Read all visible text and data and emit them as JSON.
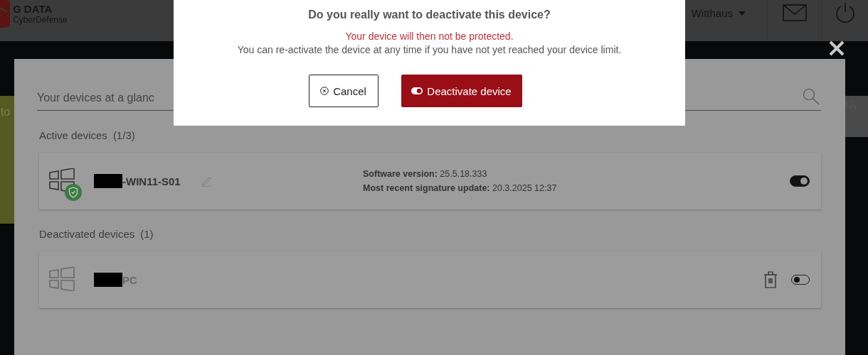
{
  "header": {
    "brand": "G DATA",
    "product": "CyberDefense",
    "user": "Witthaus"
  },
  "side_tab": "to",
  "panel": {
    "search": {
      "placeholder": "Your devices at a glanc"
    },
    "sections": [
      {
        "title": "Active devices",
        "count": "(1/3)",
        "devices": [
          {
            "name": "-WIN11-S01",
            "active": true,
            "protected": true,
            "software": "**Software version:** 25.5.18.333",
            "signature": "**Most recent signature update:** 20.3.2025 12:37"
          }
        ]
      },
      {
        "title": "Deactivated devices",
        "count": "(1)",
        "devices": [
          {
            "name": "PC",
            "active": false,
            "protected": false
          }
        ]
      }
    ]
  },
  "dialog": {
    "title": "Do you really want to deactivate this device?",
    "warning": "Your device will then not be protected.",
    "note": "You can re-activate the device at any time if you have not yet reached your device limit.",
    "cancel": "Cancel",
    "confirm": "Deactivate device"
  }
}
